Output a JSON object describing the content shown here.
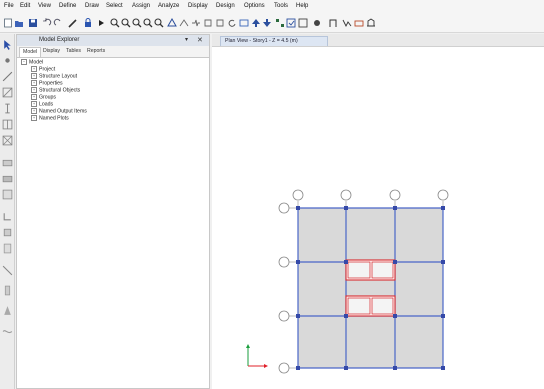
{
  "menubar": {
    "items": [
      "File",
      "Edit",
      "View",
      "Define",
      "Draw",
      "Select",
      "Assign",
      "Analyze",
      "Display",
      "Design",
      "Options",
      "Tools",
      "Help"
    ]
  },
  "toolbar": {
    "icons": [
      "new-model-icon",
      "open-icon",
      "save-icon",
      "undo-icon",
      "redo-icon",
      "pencil-icon",
      "lock-icon",
      "run-icon",
      "zoom-window-icon",
      "zoom-in-icon",
      "zoom-out-icon",
      "zoom-restore-icon",
      "pan-icon",
      "3d-view-icon",
      "plan-view-icon",
      "elevation-view-icon",
      "story-up-icon",
      "story-down-icon",
      "rotate-icon",
      "perspective-icon",
      "up-arrow-icon",
      "down-arrow-icon",
      "object-shrink-icon",
      "set-display-icon",
      "display-undeformed-icon",
      "display-forces-icon",
      "frame-icon",
      "steel-design-icon",
      "concrete-design-icon",
      "shear-wall-icon"
    ]
  },
  "left_toolbar": {
    "icons": [
      "pointer-icon",
      "draw-joint-icon",
      "draw-frame-icon",
      "draw-brace-icon",
      "draw-column-icon",
      "draw-beam-icon",
      "draw-wall-icon",
      "draw-floor-icon",
      "draw-slab-icon",
      "draw-opening-icon",
      "draw-wall-opening-icon",
      "draw-area-icon",
      "draw-link-icon",
      "draw-dimension-icon",
      "draw-reference-icon",
      "draw-tendon-icon",
      "draw-strip-icon"
    ]
  },
  "explorer": {
    "title": "Model Explorer",
    "pin": "▾",
    "close": "✕",
    "tabs": [
      "Model",
      "Display",
      "Tables",
      "Reports"
    ],
    "active_tab": "Model",
    "root": "Model",
    "children": [
      "Project",
      "Structure Layout",
      "Properties",
      "Structural Objects",
      "Groups",
      "Loads",
      "Named Output Items",
      "Named Plots"
    ]
  },
  "plan_view": {
    "tab_title": "Plan View - Story1 - Z = 4.5 (m)",
    "grid": {
      "columns": 4,
      "rows": 4
    },
    "colors": {
      "slab_fill": "#d9d9d9",
      "beam_line": "#4a66c8",
      "joint": "#3549a8",
      "opening": "#d9383c",
      "grid_bubble": "#888888",
      "axis_x": "#e0202a",
      "axis_y": "#1a9e3e"
    }
  }
}
